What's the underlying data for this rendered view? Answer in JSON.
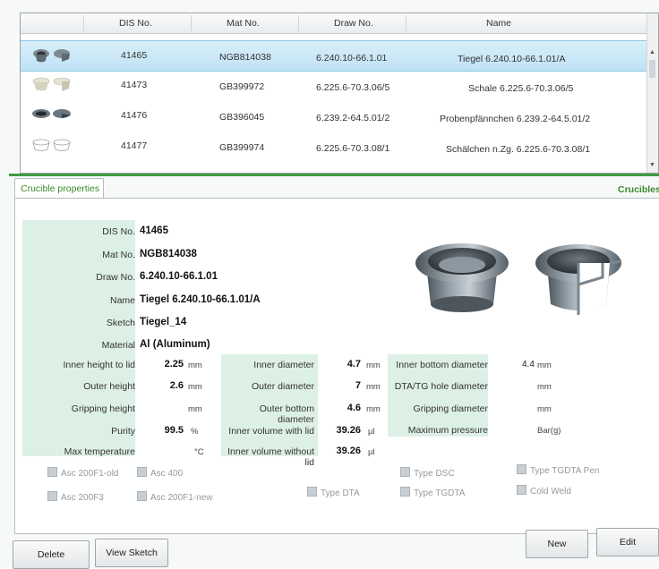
{
  "grid": {
    "columns": [
      "DIS No.",
      "Mat No.",
      "Draw No.",
      "Name"
    ],
    "rows": [
      {
        "dis": "41465",
        "mat": "NGB814038",
        "draw": "6.240.10-66.1.01",
        "name": "Tiegel 6.240.10-66.1.01/A",
        "selected": true
      },
      {
        "dis": "41473",
        "mat": "GB399972",
        "draw": "6.225.6-70.3.06/5",
        "name": "Schale 6.225.6-70.3.06/5",
        "selected": false
      },
      {
        "dis": "41476",
        "mat": "GB396045",
        "draw": "6.239.2-64.5.01/2",
        "name": "Probenpfännchen 6.239.2-64.5.01/2",
        "selected": false
      },
      {
        "dis": "41477",
        "mat": "GB399974",
        "draw": "6.225.6-70.3.08/1",
        "name": "Schälchen n.Zg. 6.225.6-70.3.08/1",
        "selected": false
      }
    ]
  },
  "tabs": {
    "active": "Crucible properties",
    "right": "Crucibles"
  },
  "props": {
    "dis_label": "DIS No.",
    "dis": "41465",
    "mat_label": "Mat No.",
    "mat": "NGB814038",
    "draw_label": "Draw No.",
    "draw": "6.240.10-66.1.01",
    "name_label": "Name",
    "name": "Tiegel 6.240.10-66.1.01/A",
    "sketch_label": "Sketch",
    "sketch": "Tiegel_14",
    "material_label": "Material",
    "material": "Al (Aluminum)"
  },
  "dims": {
    "col1": [
      {
        "label": "Inner height to lid",
        "value": "2.25",
        "unit": "mm"
      },
      {
        "label": "Outer height",
        "value": "2.6",
        "unit": "mm"
      },
      {
        "label": "Gripping height",
        "value": "",
        "unit": "mm"
      },
      {
        "label": "Purity",
        "value": "99.5",
        "unit": "%"
      },
      {
        "label": "Max temperature",
        "value": "",
        "unit": "°C"
      }
    ],
    "col2": [
      {
        "label": "Inner diameter",
        "value": "4.7",
        "unit": "mm"
      },
      {
        "label": "Outer diameter",
        "value": "7",
        "unit": "mm"
      },
      {
        "label": "Outer bottom diameter",
        "value": "4.6",
        "unit": "mm"
      },
      {
        "label": "Inner volume with lid",
        "value": "39.26",
        "unit": "µl"
      },
      {
        "label": "Inner volume without lid",
        "value": "39.26",
        "unit": "µl"
      }
    ],
    "col3": [
      {
        "label": "Inner bottom diameter",
        "value": "4.4",
        "unit": "mm"
      },
      {
        "label": "DTA/TG hole diameter",
        "value": "",
        "unit": "mm"
      },
      {
        "label": "Gripping diameter",
        "value": "",
        "unit": "mm"
      },
      {
        "label": "Maximum pressure",
        "value": "",
        "unit": "Bar(g)"
      }
    ]
  },
  "checks": {
    "asc200f1old": "Asc 200F1-old",
    "asc400": "Asc 400",
    "asc200f3": "Asc 200F3",
    "asc200f1new": "Asc 200F1-new",
    "typedta": "Type DTA",
    "typedsc": "Type DSC",
    "typetgdta": "Type TGDTA",
    "typetgdtapen": "Type TGDTA Pen",
    "coldweld": "Cold Weld"
  },
  "buttons": {
    "delete": "Delete",
    "view_sketch": "View Sketch",
    "new": "New",
    "edit": "Edit"
  },
  "colors": {
    "accent_green": "#3e9b3e",
    "label_bg": "#ddf0e6",
    "selected_row": "#bfe2f5"
  }
}
